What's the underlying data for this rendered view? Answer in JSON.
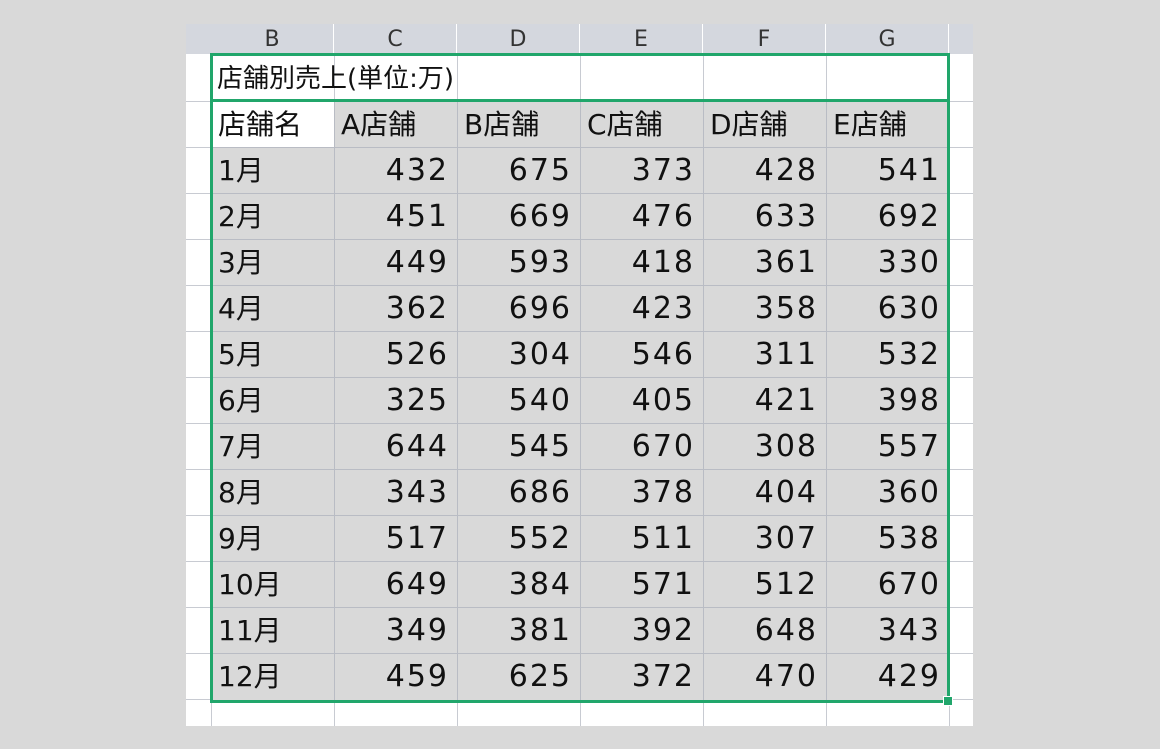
{
  "spreadsheet": {
    "column_headers": [
      "B",
      "C",
      "D",
      "E",
      "F",
      "G"
    ],
    "title": "店舗別売上(単位:万)",
    "table": {
      "headers": [
        "店舗名",
        "A店舗",
        "B店舗",
        "C店舗",
        "D店舗",
        "E店舗"
      ],
      "rows": [
        [
          "1月",
          "432",
          "675",
          "373",
          "428",
          "541"
        ],
        [
          "2月",
          "451",
          "669",
          "476",
          "633",
          "692"
        ],
        [
          "3月",
          "449",
          "593",
          "418",
          "361",
          "330"
        ],
        [
          "4月",
          "362",
          "696",
          "423",
          "358",
          "630"
        ],
        [
          "5月",
          "526",
          "304",
          "546",
          "311",
          "532"
        ],
        [
          "6月",
          "325",
          "540",
          "405",
          "421",
          "398"
        ],
        [
          "7月",
          "644",
          "545",
          "670",
          "308",
          "557"
        ],
        [
          "8月",
          "343",
          "686",
          "378",
          "404",
          "360"
        ],
        [
          "9月",
          "517",
          "552",
          "511",
          "307",
          "538"
        ],
        [
          "10月",
          "649",
          "384",
          "571",
          "512",
          "670"
        ],
        [
          "11月",
          "349",
          "381",
          "392",
          "648",
          "343"
        ],
        [
          "12月",
          "459",
          "625",
          "372",
          "470",
          "429"
        ]
      ]
    },
    "selection_color": "#21a66b",
    "selected_fill": "#d9d9d9"
  }
}
